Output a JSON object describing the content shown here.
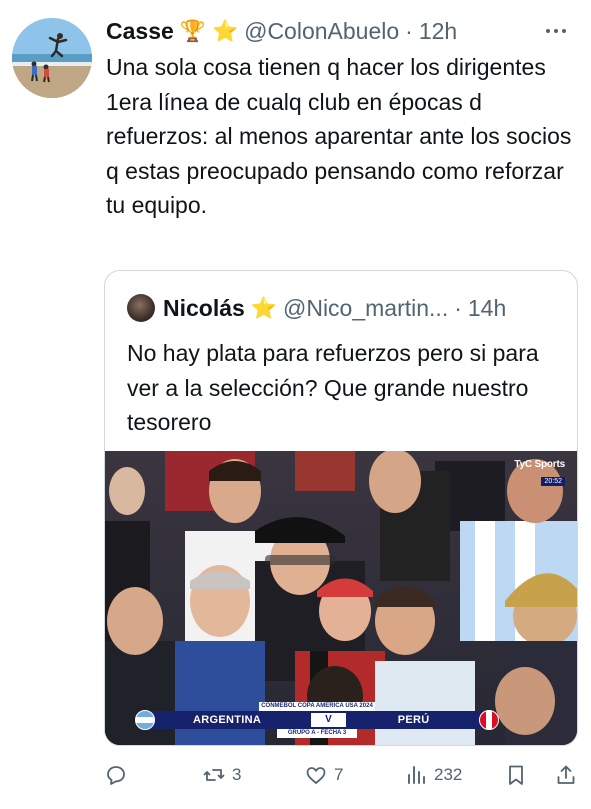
{
  "author": {
    "name": "Casse",
    "badges": [
      "🏆",
      "⭐"
    ],
    "handle": "@ColonAbuelo",
    "separator": "·",
    "time": "12h"
  },
  "tweet_text": "Una sola cosa tienen q hacer los dirigentes 1era línea de cualq club en épocas d refuerzos: al menos aparentar ante los socios q estas preocupado pensando como reforzar tu equipo.",
  "quoted": {
    "name": "Nicolás",
    "badge": "⭐",
    "handle": "@Nico_martin...",
    "separator": "·",
    "time": "14h",
    "text": "No hay plata para refuerzos pero si para ver a la selección? Que grande nuestro tesorero",
    "media": {
      "broadcaster": "TyC Sports",
      "clock": "20:52",
      "competition": "CONMEBOL COPA AMERICA USA 2024",
      "team_home": "ARGENTINA",
      "versus": "V",
      "team_away": "PERÚ",
      "stage": "GRUPO A - FECHA 3"
    }
  },
  "actions": {
    "retweets": "3",
    "likes": "7",
    "views": "232"
  },
  "icons": {
    "more": "more-dots-icon",
    "reply": "reply-icon",
    "retweet": "retweet-icon",
    "like": "heart-icon",
    "views": "views-chart-icon",
    "bookmark": "bookmark-icon",
    "share": "share-icon"
  },
  "colors": {
    "text_primary": "#0f1419",
    "text_secondary": "#536471",
    "border": "#cfd9de",
    "score_bar": "#16226b"
  }
}
